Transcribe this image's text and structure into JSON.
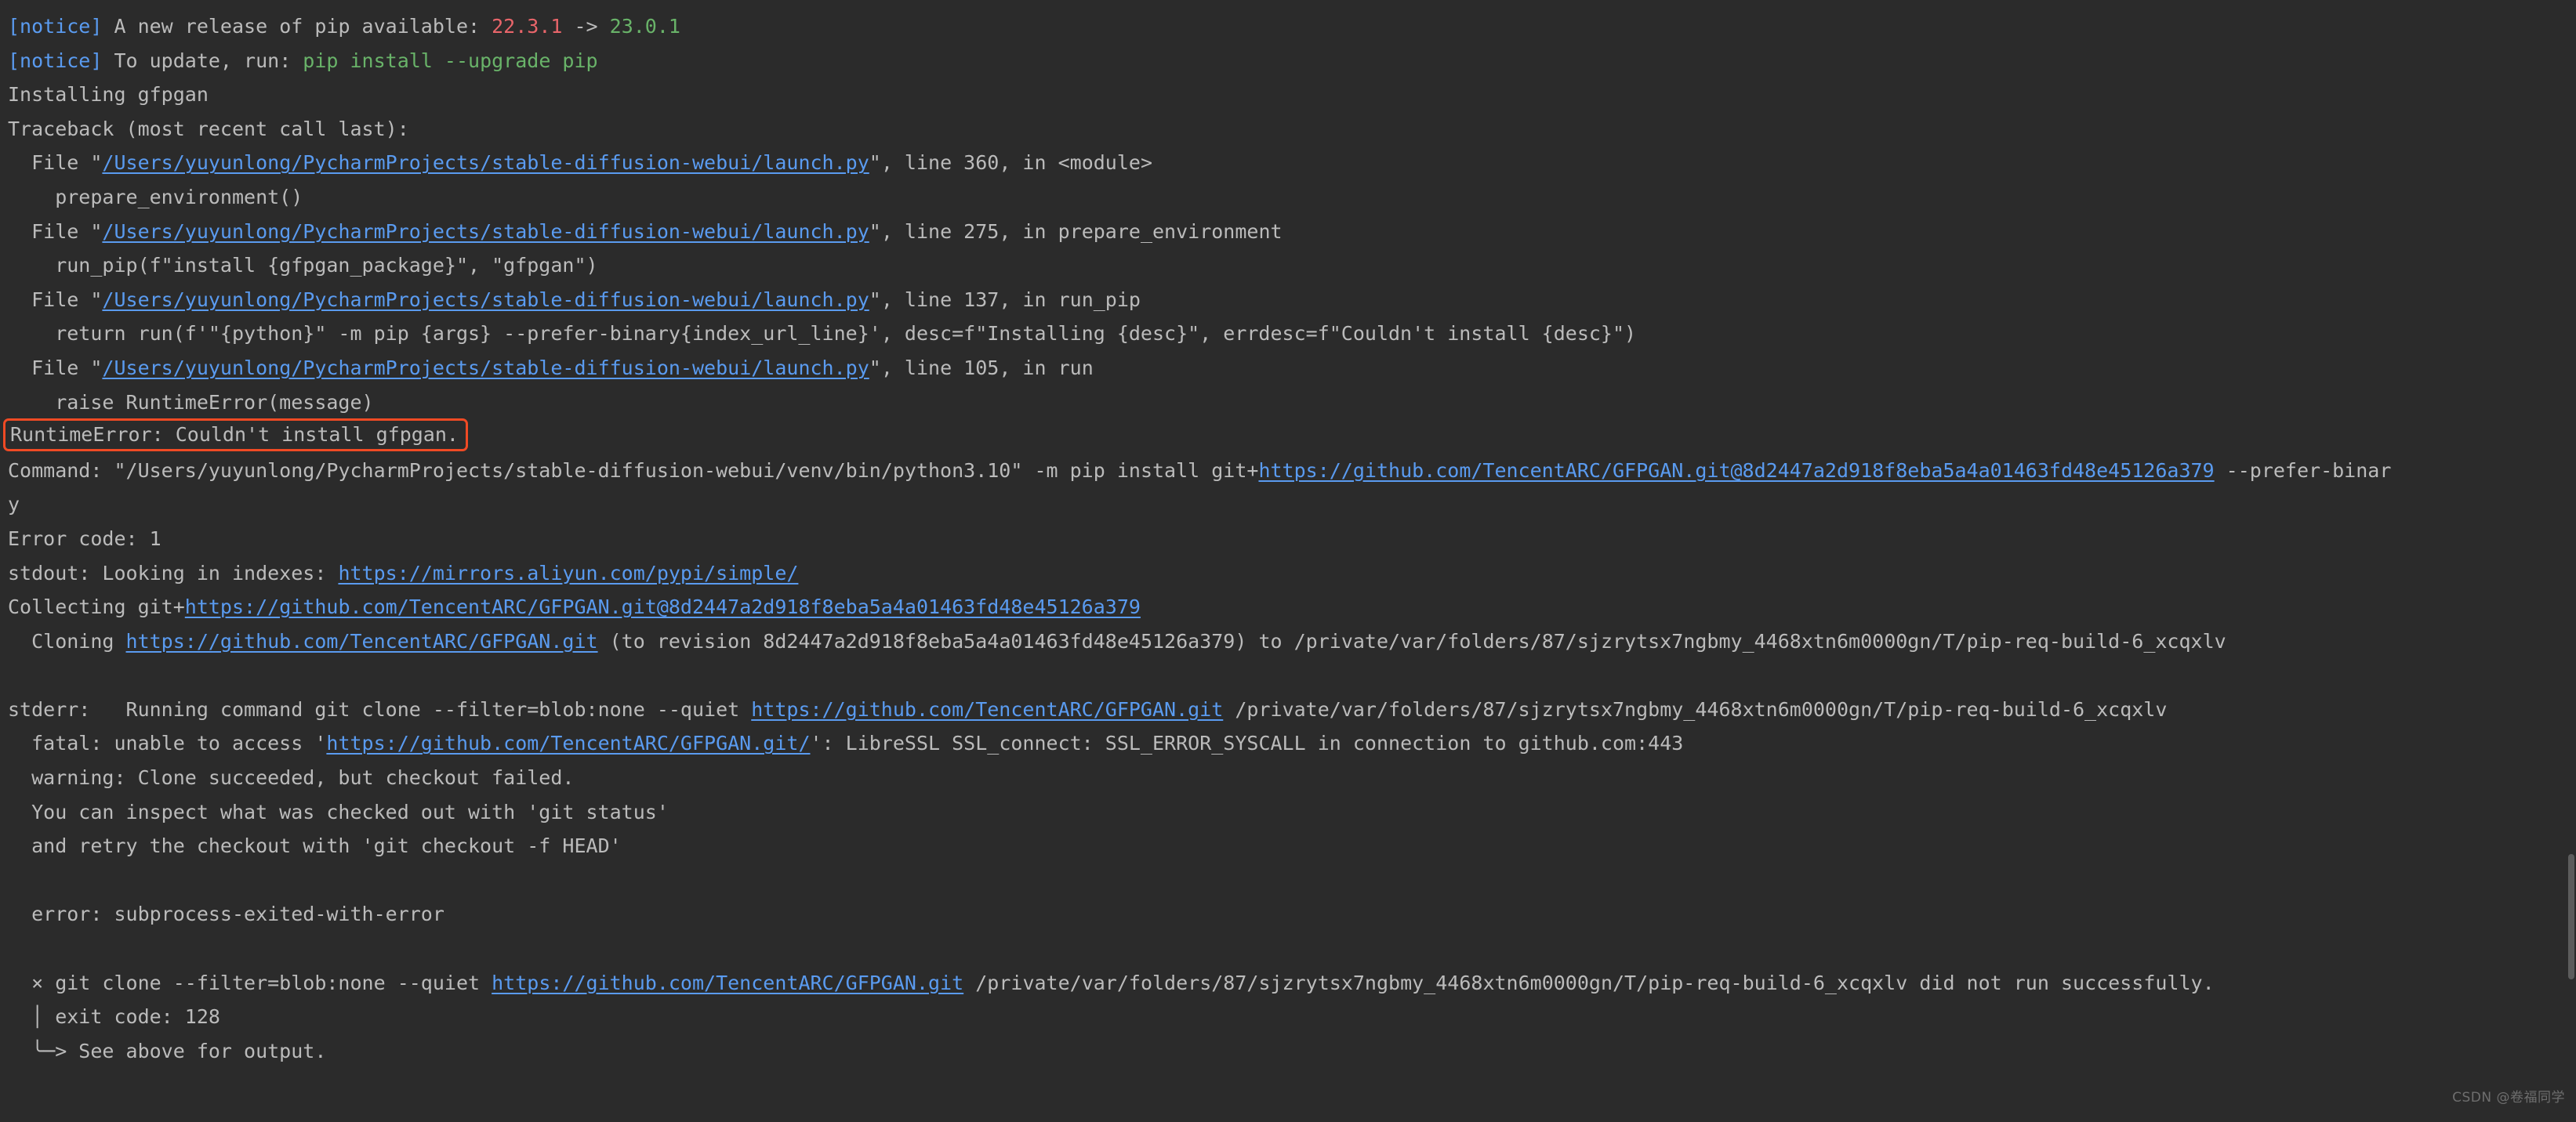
{
  "terminal": {
    "background": "#2b2b2b",
    "text_color": "#bbbbbb",
    "link_color": "#5a9bf0",
    "error_box_color": "#f04a24",
    "green": "#69b369",
    "red": "#e8656a"
  },
  "paths": {
    "launch_py": "/Users/yuyunlong/PycharmProjects/stable-diffusion-webui/launch.py",
    "python_bin": "/Users/yuyunlong/PycharmProjects/stable-diffusion-webui/venv/bin/python3.10",
    "tmp_build": "/private/var/folders/87/sjzrytsx7ngbmy_4468xtn6m0000gn/T/pip-req-build-6_xcqxlv",
    "gfpgan_repo": "https://github.com/TencentARC/GFPGAN.git",
    "gfpgan_repo_slash": "https://github.com/TencentARC/GFPGAN.git/",
    "gfpgan_pinned": "https://github.com/TencentARC/GFPGAN.git@8d2447a2d918f8eba5a4a01463fd48e45126a379",
    "pypi_index": "https://mirrors.aliyun.com/pypi/simple/",
    "revision": "8d2447a2d918f8eba5a4a01463fd48e45126a379"
  },
  "lines": {
    "notice1_tag": "[notice]",
    "notice1_text": " A new release of pip available: ",
    "notice1_old": "22.3.1",
    "notice1_arrow": " -> ",
    "notice1_new": "23.0.1",
    "notice2_tag": "[notice]",
    "notice2_text": " To update, run: ",
    "notice2_cmd": "pip install --upgrade pip",
    "installing": "Installing gfpgan",
    "traceback_header": "Traceback (most recent call last):",
    "file_prefix": "  File \"",
    "file_suffix_1": "\", line 360, in <module>",
    "file_suffix_2": "\", line 275, in prepare_environment",
    "file_suffix_3": "\", line 137, in run_pip",
    "file_suffix_4": "\", line 105, in run",
    "frame_body_1": "    prepare_environment()",
    "frame_body_2": "    run_pip(f\"install {gfpgan_package}\", \"gfpgan\")",
    "frame_body_3": "    return run(f'\"{python}\" -m pip {args} --prefer-binary{index_url_line}', desc=f\"Installing {desc}\", errdesc=f\"Couldn't install {desc}\")",
    "frame_body_4": "    raise RuntimeError(message)",
    "runtime_error": "RuntimeError: Couldn't install gfpgan.",
    "command_prefix": "Command: \"",
    "command_mid": "\" -m pip install git+",
    "command_suffix": " --prefer-binar",
    "command_wrap": "y",
    "error_code": "Error code: 1",
    "stdout_prefix": "stdout: Looking in indexes: ",
    "collecting_prefix": "Collecting git+",
    "cloning_prefix": "  Cloning ",
    "cloning_mid": " (to revision ",
    "cloning_suffix": ") to ",
    "stderr_prefix": "stderr:   Running command git clone --filter=blob:none --quiet ",
    "stderr_suffix": " ",
    "fatal_prefix": "  fatal: unable to access '",
    "fatal_suffix": "': LibreSSL SSL_connect: SSL_ERROR_SYSCALL in connection to github.com:443",
    "warning_clone": "  warning: Clone succeeded, but checkout failed.",
    "inspect_line": "  You can inspect what was checked out with 'git status'",
    "retry_line": "  and retry the checkout with 'git checkout -f HEAD'",
    "subprocess_error": "  error: subprocess-exited-with-error",
    "git_clone_prefix": "  × git clone --filter=blob:none --quiet ",
    "git_clone_suffix": " did not run successfully.",
    "exit_code": "  │ exit code: 128",
    "see_above": "  ╰─> See above for output."
  },
  "watermark": "CSDN @卷福同学"
}
